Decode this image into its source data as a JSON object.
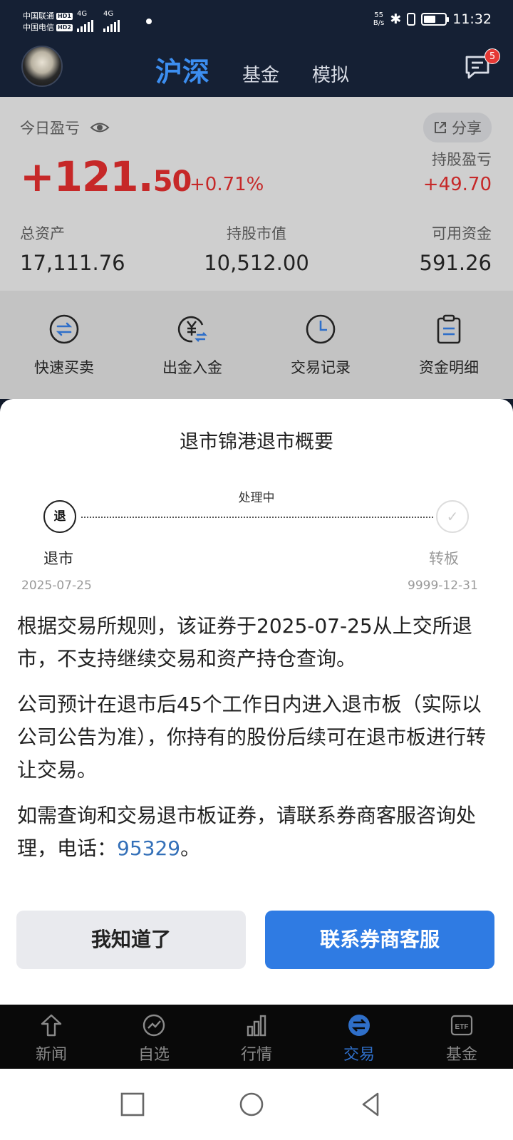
{
  "status_bar": {
    "carrier1": "中国联通",
    "carrier2": "中国电信",
    "hd1": "HD1",
    "hd2": "HD2",
    "net1": "4G",
    "net2": "4G",
    "speed_value": "55",
    "speed_unit": "B/s",
    "time": "11:32",
    "battery_level": 0.55
  },
  "header": {
    "tabs": [
      {
        "label": "沪深",
        "active": true
      },
      {
        "label": "基金",
        "active": false
      },
      {
        "label": "模拟",
        "active": false
      }
    ],
    "message_badge": "5"
  },
  "account": {
    "today_pnl_label": "今日盈亏",
    "share_label": "分享",
    "today_pnl_int": "+121.",
    "today_pnl_dec": "50",
    "today_pnl_pct": "+0.71%",
    "holding_pnl_label": "持股盈亏",
    "holding_pnl_value": "+49.70",
    "stats": [
      {
        "label": "总资产",
        "value": "17,111.76"
      },
      {
        "label": "持股市值",
        "value": "10,512.00"
      },
      {
        "label": "可用资金",
        "value": "591.26"
      }
    ]
  },
  "quick_actions": [
    {
      "label": "快速买卖",
      "icon": "swap-icon"
    },
    {
      "label": "出金入金",
      "icon": "yuan-transfer-icon"
    },
    {
      "label": "交易记录",
      "icon": "clock-icon"
    },
    {
      "label": "资金明细",
      "icon": "clipboard-icon"
    }
  ],
  "modal": {
    "title": "退市锦港退市概要",
    "status_label": "处理中",
    "start_node_char": "退",
    "start_label": "退市",
    "start_date": "2025-07-25",
    "end_label": "转板",
    "end_date": "9999-12-31",
    "paragraph1": "根据交易所规则，该证券于2025-07-25从上交所退市，不支持继续交易和资产持仓查询。",
    "paragraph2": "公司预计在退市后45个工作日内进入退市板（实际以公司公告为准），你持有的股份后续可在退市板进行转让交易。",
    "paragraph3_prefix": "如需查询和交易退市板证券，请联系券商客服咨询处理，电话：",
    "phone": "95329",
    "paragraph3_suffix": "。",
    "btn_ok": "我知道了",
    "btn_contact": "联系券商客服"
  },
  "bottom_nav": [
    {
      "label": "新闻",
      "icon": "news-icon"
    },
    {
      "label": "自选",
      "icon": "watchlist-icon"
    },
    {
      "label": "行情",
      "icon": "market-icon"
    },
    {
      "label": "交易",
      "icon": "trade-icon",
      "active": true
    },
    {
      "label": "基金",
      "icon": "etf-icon"
    }
  ],
  "colors": {
    "accent_blue": "#2f7be3",
    "gain_red": "#c62828",
    "header_bg": "#152034"
  }
}
